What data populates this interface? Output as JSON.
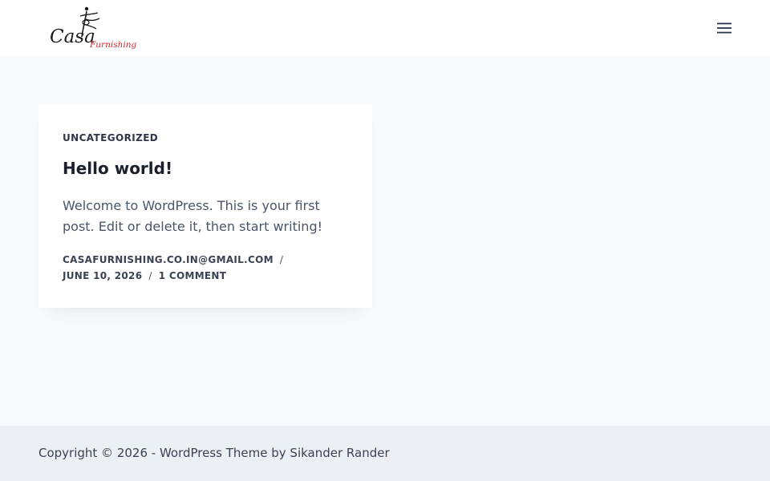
{
  "header": {
    "logo_alt": "Casa Furnishing",
    "logo_text_main": "Casa",
    "logo_text_sub": "Furnishing",
    "menu_icon": "hamburger-menu-icon"
  },
  "post": {
    "category": "UNCATEGORIZED",
    "title": "Hello world!",
    "excerpt": "Welcome to WordPress. This is your first post. Edit or delete it, then start writing!",
    "author": "CASAFURNISHING.CO.IN@GMAIL.COM",
    "separator": "/",
    "date": "JUNE 10, 2026",
    "comments": "1 COMMENT"
  },
  "footer": {
    "copyright": "Copyright © 2026 - WordPress Theme by Sikander Rander"
  },
  "colors": {
    "page_bg": "#f7f9fc",
    "header_bg": "#ffffff",
    "footer_bg": "#eceff3",
    "logo_red": "#d0262d",
    "text_dark": "#1a202c"
  }
}
